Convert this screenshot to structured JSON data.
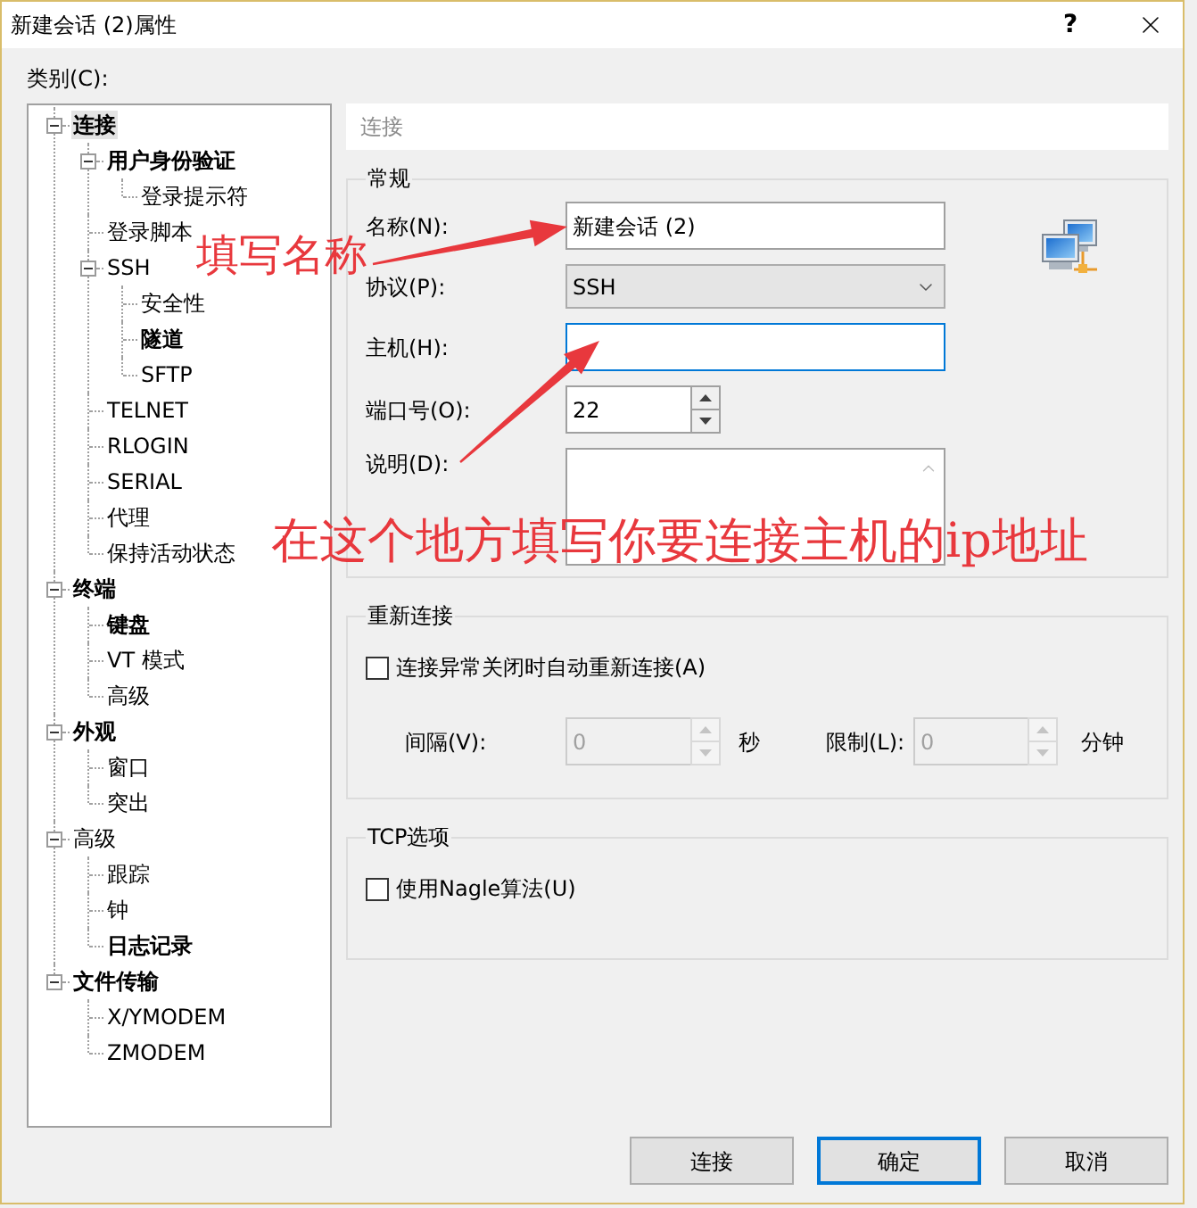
{
  "window": {
    "title": "新建会话 (2)属性",
    "help": "?"
  },
  "category_label": "类别(C):",
  "tree": [
    {
      "label": "连接",
      "bold": true,
      "selected": true,
      "expanded": true,
      "children": [
        {
          "label": "用户身份验证",
          "bold": true,
          "selected": false,
          "expanded": true,
          "children": [
            {
              "label": "登录提示符",
              "bold": false,
              "selected": false
            }
          ]
        },
        {
          "label": "登录脚本",
          "bold": false,
          "selected": false
        },
        {
          "label": "SSH",
          "bold": false,
          "selected": false,
          "expanded": true,
          "children": [
            {
              "label": "安全性",
              "bold": false,
              "selected": false
            },
            {
              "label": "隧道",
              "bold": true,
              "selected": false
            },
            {
              "label": "SFTP",
              "bold": false,
              "selected": false
            }
          ]
        },
        {
          "label": "TELNET",
          "bold": false,
          "selected": false
        },
        {
          "label": "RLOGIN",
          "bold": false,
          "selected": false
        },
        {
          "label": "SERIAL",
          "bold": false,
          "selected": false
        },
        {
          "label": "代理",
          "bold": false,
          "selected": false
        },
        {
          "label": "保持活动状态",
          "bold": false,
          "selected": false
        }
      ]
    },
    {
      "label": "终端",
      "bold": true,
      "selected": false,
      "expanded": true,
      "children": [
        {
          "label": "键盘",
          "bold": true,
          "selected": false
        },
        {
          "label": "VT 模式",
          "bold": false,
          "selected": false
        },
        {
          "label": "高级",
          "bold": false,
          "selected": false
        }
      ]
    },
    {
      "label": "外观",
      "bold": true,
      "selected": false,
      "expanded": true,
      "children": [
        {
          "label": "窗口",
          "bold": false,
          "selected": false
        },
        {
          "label": "突出",
          "bold": false,
          "selected": false
        }
      ]
    },
    {
      "label": "高级",
      "bold": false,
      "selected": false,
      "expanded": true,
      "children": [
        {
          "label": "跟踪",
          "bold": false,
          "selected": false
        },
        {
          "label": "钟",
          "bold": false,
          "selected": false
        },
        {
          "label": "日志记录",
          "bold": true,
          "selected": false
        }
      ]
    },
    {
      "label": "文件传输",
      "bold": true,
      "selected": false,
      "expanded": true,
      "children": [
        {
          "label": "X/YMODEM",
          "bold": false,
          "selected": false
        },
        {
          "label": "ZMODEM",
          "bold": false,
          "selected": false
        }
      ]
    }
  ],
  "page_title": "连接",
  "general": {
    "title": "常规",
    "fields": [
      {
        "kind": "text",
        "label": "名称(N):",
        "value": "新建会话 (2)",
        "focused": false
      },
      {
        "kind": "select",
        "label": "协议(P):",
        "value": "SSH"
      },
      {
        "kind": "text",
        "label": "主机(H):",
        "focused": true
      },
      {
        "kind": "spin",
        "label": "端口号(O):",
        "value": "22"
      },
      {
        "kind": "textarea",
        "label": "说明(D):"
      }
    ]
  },
  "reconnect": {
    "title": "重新连接",
    "checkbox": {
      "label": "连接异常关闭时自动重新连接(A)",
      "checked": false
    },
    "spins": [
      {
        "label": "间隔(V):",
        "value": "0",
        "unit": "秒",
        "disabled": true
      },
      {
        "label": "限制(L):",
        "value": "0",
        "unit": "分钟",
        "disabled": true
      }
    ]
  },
  "tcp_options": {
    "title": "TCP选项",
    "checkbox": {
      "label": "使用Nagle算法(U)",
      "checked": false
    }
  },
  "buttons": [
    {
      "label": "连接",
      "default": false
    },
    {
      "label": "确定",
      "default": true
    },
    {
      "label": "取消",
      "default": false
    }
  ],
  "annotations": [
    {
      "text": "填写名称"
    },
    {
      "text": "在这个地方填写你要连接主机的ip地址"
    }
  ]
}
